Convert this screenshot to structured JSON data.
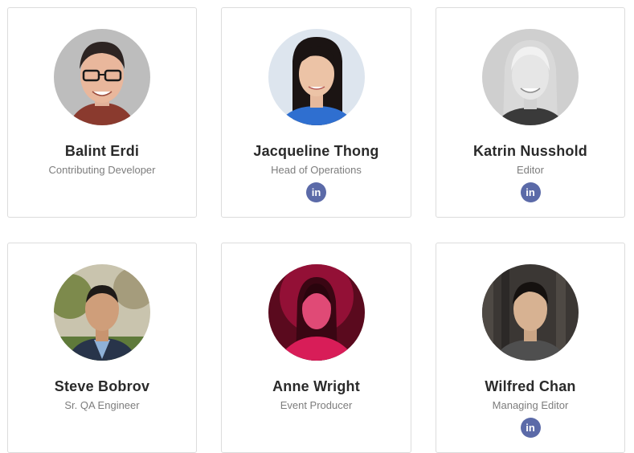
{
  "team": [
    {
      "name": "Balint Erdi",
      "role": "Contributing Developer",
      "linkedin": false,
      "linkedin_label": ""
    },
    {
      "name": "Jacqueline Thong",
      "role": "Head of Operations",
      "linkedin": true,
      "linkedin_label": "in"
    },
    {
      "name": "Katrin Nusshold",
      "role": "Editor",
      "linkedin": true,
      "linkedin_label": "in"
    },
    {
      "name": "Steve Bobrov",
      "role": "Sr. QA Engineer",
      "linkedin": false,
      "linkedin_label": ""
    },
    {
      "name": "Anne Wright",
      "role": "Event Producer",
      "linkedin": false,
      "linkedin_label": ""
    },
    {
      "name": "Wilfred Chan",
      "role": "Managing Editor",
      "linkedin": true,
      "linkedin_label": "in"
    }
  ],
  "colors": {
    "card_border": "#dcdcdc",
    "name_text": "#2a2a2a",
    "role_text": "#7d7d7d",
    "linkedin_badge": "#5b6aa8"
  }
}
